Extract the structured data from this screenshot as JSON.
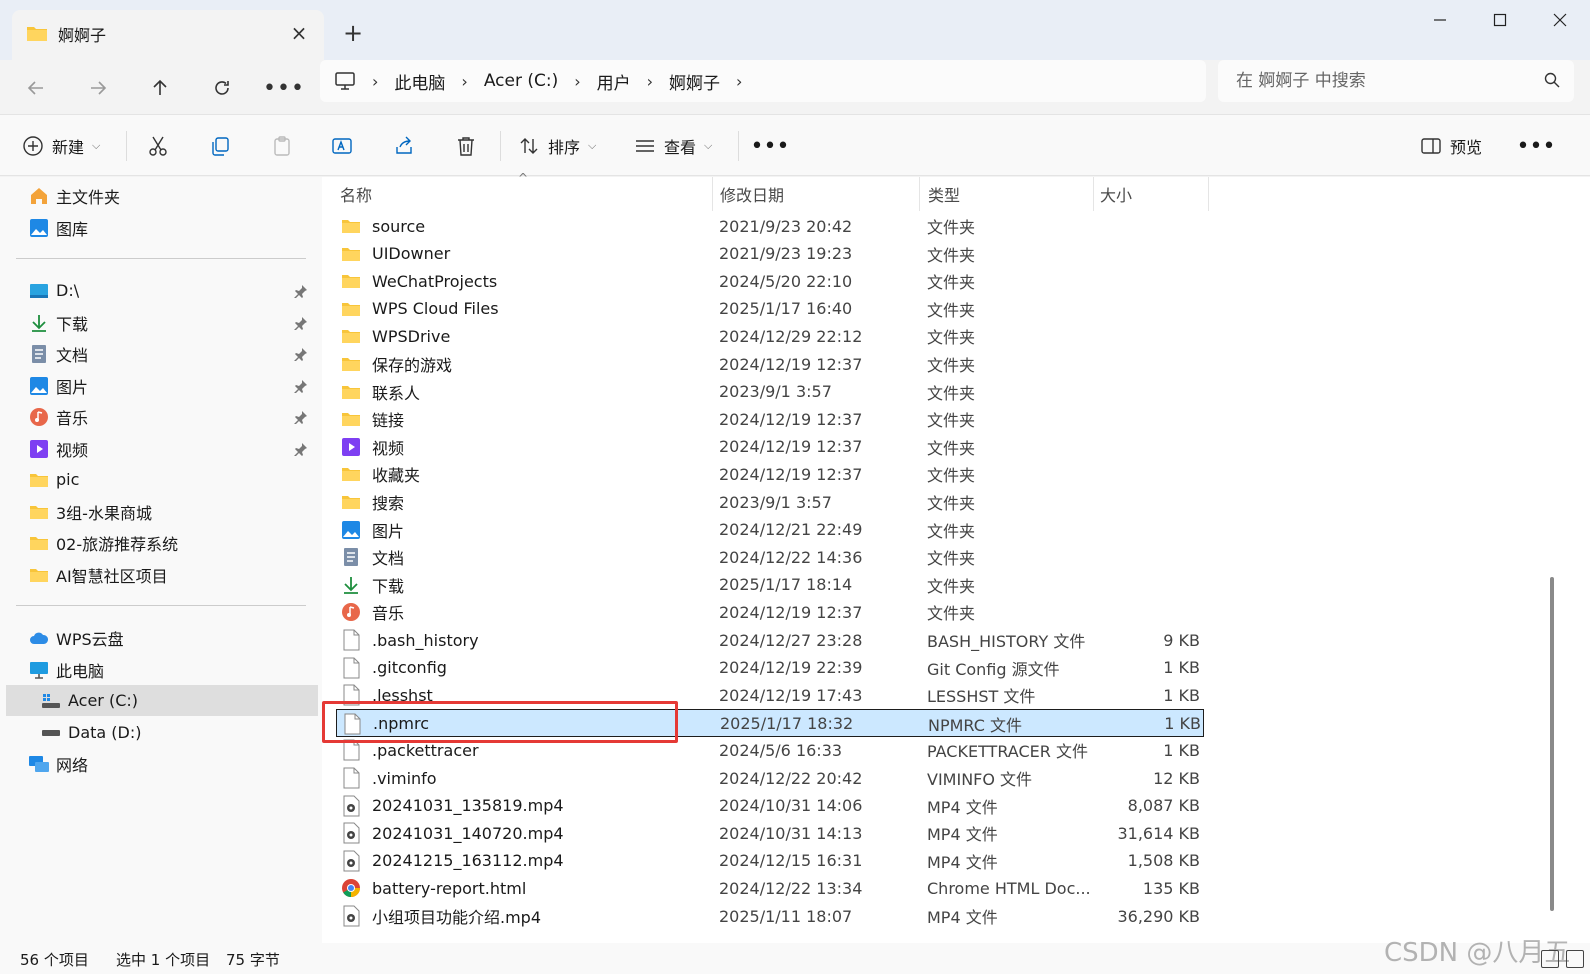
{
  "tab": {
    "title": "婀婀子"
  },
  "breadcrumb": [
    "此电脑",
    "Acer (C:)",
    "用户",
    "婀婀子"
  ],
  "search": {
    "placeholder": "在 婀婀子 中搜索"
  },
  "toolbar": {
    "new_label": "新建",
    "sort_label": "排序",
    "view_label": "查看",
    "preview_label": "预览"
  },
  "sidebar": {
    "top": [
      {
        "label": "主文件夹",
        "icon": "home-icon"
      },
      {
        "label": "图库",
        "icon": "gallery-icon"
      }
    ],
    "pinned": [
      {
        "label": "D:\\",
        "icon": "drive-icon"
      },
      {
        "label": "下载",
        "icon": "download-icon"
      },
      {
        "label": "文档",
        "icon": "document-icon"
      },
      {
        "label": "图片",
        "icon": "pictures-icon"
      },
      {
        "label": "音乐",
        "icon": "music-icon"
      },
      {
        "label": "视频",
        "icon": "video-icon"
      },
      {
        "label": "pic",
        "icon": "folder-icon"
      },
      {
        "label": "3组-水果商城",
        "icon": "folder-icon"
      },
      {
        "label": "02-旅游推荐系统",
        "icon": "folder-icon"
      },
      {
        "label": "AI智慧社区项目",
        "icon": "folder-icon"
      }
    ],
    "devices": [
      {
        "label": "WPS云盘",
        "icon": "cloud-icon"
      },
      {
        "label": "此电脑",
        "icon": "computer-icon"
      },
      {
        "label": "Acer (C:)",
        "icon": "system-drive-icon"
      },
      {
        "label": "Data (D:)",
        "icon": "drive-icon"
      },
      {
        "label": "网络",
        "icon": "network-icon"
      }
    ]
  },
  "columns": {
    "name": "名称",
    "date": "修改日期",
    "type": "类型",
    "size": "大小"
  },
  "files": [
    {
      "name": "source",
      "date": "2021/9/23 20:42",
      "type": "文件夹",
      "size": "",
      "icon": "folder"
    },
    {
      "name": "UIDowner",
      "date": "2021/9/23 19:23",
      "type": "文件夹",
      "size": "",
      "icon": "folder"
    },
    {
      "name": "WeChatProjects",
      "date": "2024/5/20 22:10",
      "type": "文件夹",
      "size": "",
      "icon": "folder"
    },
    {
      "name": "WPS Cloud Files",
      "date": "2025/1/17 16:40",
      "type": "文件夹",
      "size": "",
      "icon": "folder"
    },
    {
      "name": "WPSDrive",
      "date": "2024/12/29 22:12",
      "type": "文件夹",
      "size": "",
      "icon": "folder"
    },
    {
      "name": "保存的游戏",
      "date": "2024/12/19 12:37",
      "type": "文件夹",
      "size": "",
      "icon": "folder"
    },
    {
      "name": "联系人",
      "date": "2023/9/1 3:57",
      "type": "文件夹",
      "size": "",
      "icon": "folder"
    },
    {
      "name": "链接",
      "date": "2024/12/19 12:37",
      "type": "文件夹",
      "size": "",
      "icon": "folder"
    },
    {
      "name": "视频",
      "date": "2024/12/19 12:37",
      "type": "文件夹",
      "size": "",
      "icon": "video"
    },
    {
      "name": "收藏夹",
      "date": "2024/12/19 12:37",
      "type": "文件夹",
      "size": "",
      "icon": "folder"
    },
    {
      "name": "搜索",
      "date": "2023/9/1 3:57",
      "type": "文件夹",
      "size": "",
      "icon": "folder"
    },
    {
      "name": "图片",
      "date": "2024/12/21 22:49",
      "type": "文件夹",
      "size": "",
      "icon": "pictures"
    },
    {
      "name": "文档",
      "date": "2024/12/22 14:36",
      "type": "文件夹",
      "size": "",
      "icon": "document"
    },
    {
      "name": "下载",
      "date": "2025/1/17 18:14",
      "type": "文件夹",
      "size": "",
      "icon": "download"
    },
    {
      "name": "音乐",
      "date": "2024/12/19 12:37",
      "type": "文件夹",
      "size": "",
      "icon": "music"
    },
    {
      "name": ".bash_history",
      "date": "2024/12/27 23:28",
      "type": "BASH_HISTORY 文件",
      "size": "9 KB",
      "icon": "file"
    },
    {
      "name": ".gitconfig",
      "date": "2024/12/19 22:39",
      "type": "Git Config 源文件",
      "size": "1 KB",
      "icon": "file"
    },
    {
      "name": ".lesshst",
      "date": "2024/12/19 17:43",
      "type": "LESSHST 文件",
      "size": "1 KB",
      "icon": "file"
    },
    {
      "name": ".npmrc",
      "date": "2025/1/17 18:32",
      "type": "NPMRC 文件",
      "size": "1 KB",
      "icon": "file",
      "selected": true
    },
    {
      "name": ".packettracer",
      "date": "2024/5/6 16:33",
      "type": "PACKETTRACER 文件",
      "size": "1 KB",
      "icon": "file"
    },
    {
      "name": ".viminfo",
      "date": "2024/12/22 20:42",
      "type": "VIMINFO 文件",
      "size": "12 KB",
      "icon": "file"
    },
    {
      "name": "20241031_135819.mp4",
      "date": "2024/10/31 14:06",
      "type": "MP4 文件",
      "size": "8,087 KB",
      "icon": "mp4"
    },
    {
      "name": "20241031_140720.mp4",
      "date": "2024/10/31 14:13",
      "type": "MP4 文件",
      "size": "31,614 KB",
      "icon": "mp4"
    },
    {
      "name": "20241215_163112.mp4",
      "date": "2024/12/15 16:31",
      "type": "MP4 文件",
      "size": "1,508 KB",
      "icon": "mp4"
    },
    {
      "name": "battery-report.html",
      "date": "2024/12/22 13:34",
      "type": "Chrome HTML Doc...",
      "size": "135 KB",
      "icon": "chrome"
    },
    {
      "name": "小组项目功能介绍.mp4",
      "date": "2025/1/11 18:07",
      "type": "MP4 文件",
      "size": "36,290 KB",
      "icon": "mp4"
    }
  ],
  "status": {
    "count": "56 个项目",
    "selected": "选中 1 个项目",
    "bytes": "75 字节"
  },
  "watermark": "CSDN @八月五",
  "colors": {
    "accent": "#0067c0",
    "selection": "#cce8ff",
    "folder": "#f8c53a",
    "highlight": "#e53935"
  }
}
